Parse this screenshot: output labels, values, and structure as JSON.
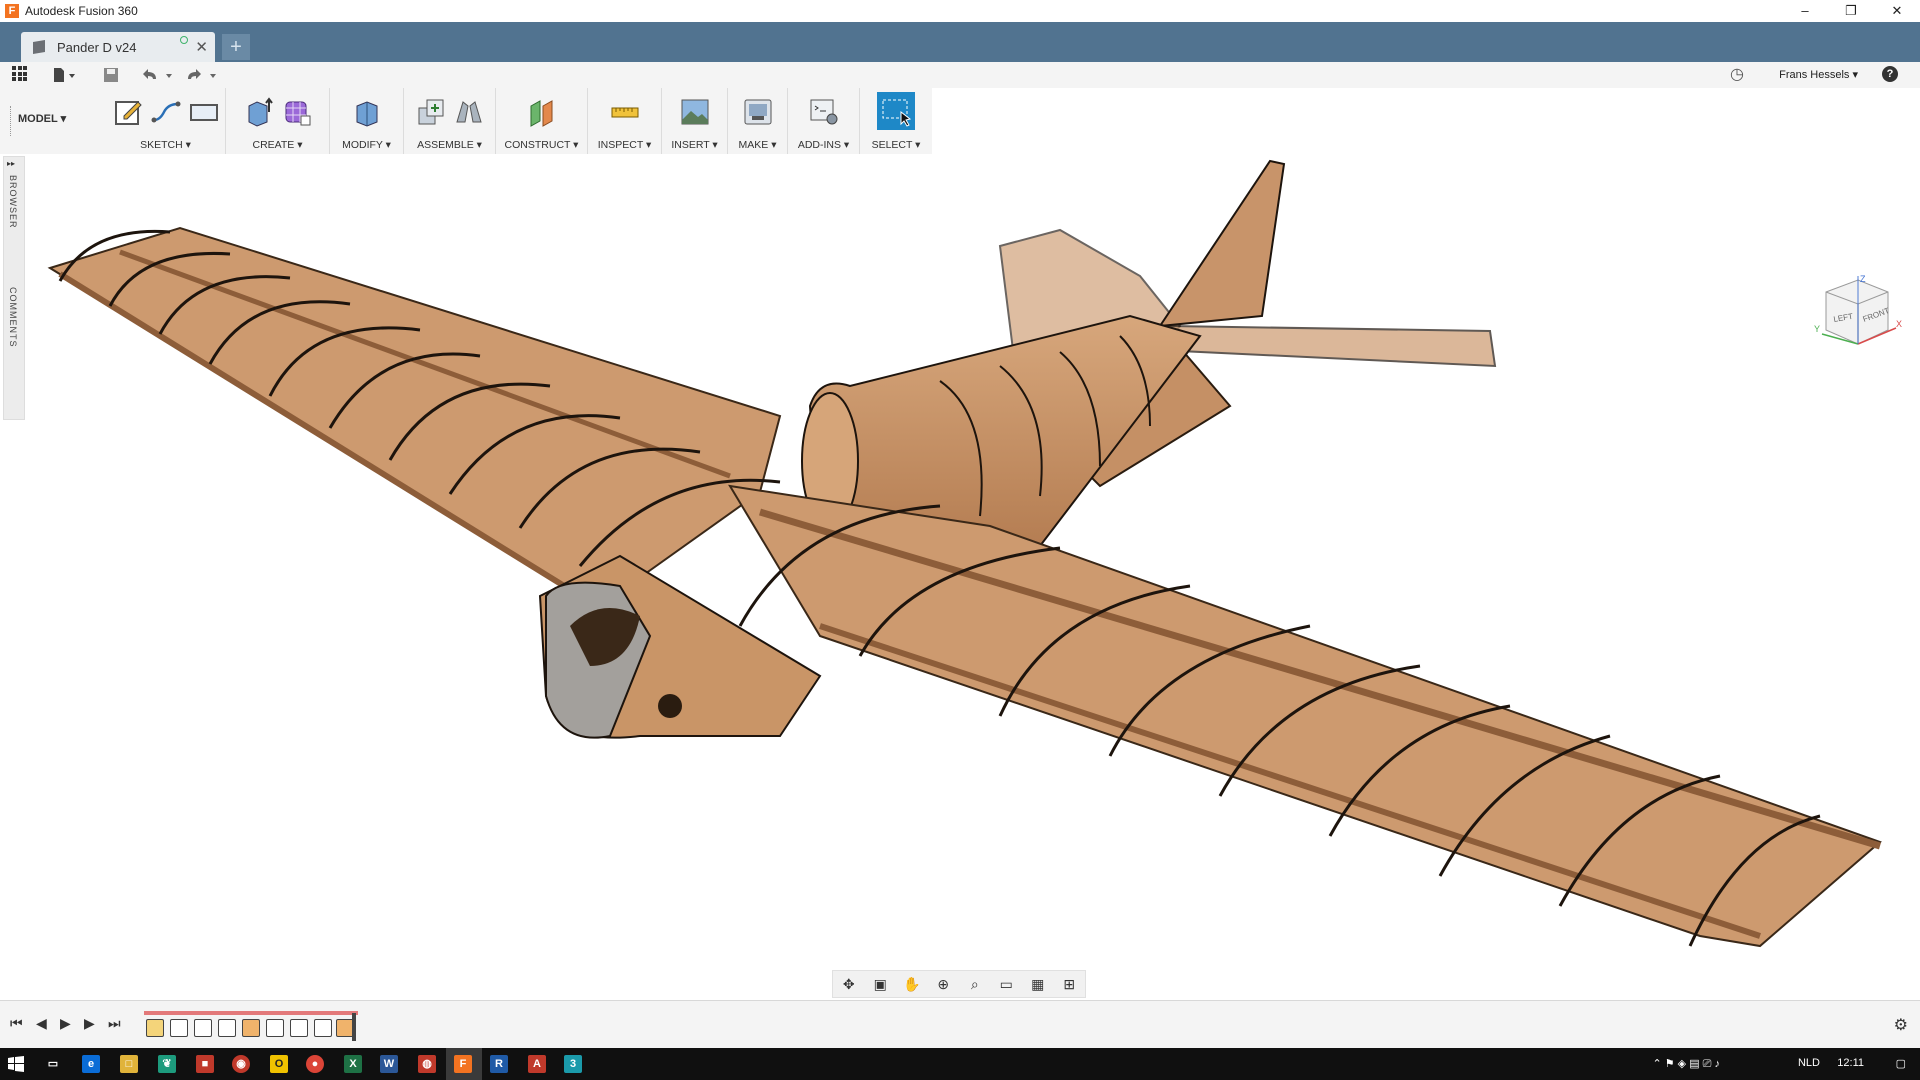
{
  "window": {
    "app_title": "Autodesk Fusion 360",
    "controls": [
      "–",
      "❐",
      "✕"
    ]
  },
  "tabs": {
    "document_title": "Pander D v24",
    "close_glyph": "✕",
    "new_tab_glyph": "+"
  },
  "quick_access": {
    "user_name": "Frans Hessels",
    "user_caret": "▾",
    "help_glyph": "?",
    "clock_glyph": "◷"
  },
  "toolbar": {
    "workspace": "MODEL ▾",
    "groups": [
      {
        "label": "SKETCH ▾"
      },
      {
        "label": "CREATE ▾"
      },
      {
        "label": "MODIFY ▾"
      },
      {
        "label": "ASSEMBLE ▾"
      },
      {
        "label": "CONSTRUCT ▾"
      },
      {
        "label": "INSPECT ▾"
      },
      {
        "label": "INSERT ▾"
      },
      {
        "label": "MAKE ▾"
      },
      {
        "label": "ADD-INS ▾"
      },
      {
        "label": "SELECT ▾"
      }
    ]
  },
  "left_panel": {
    "expand_glyph": "▸▸",
    "browser_label": "BROWSER",
    "comments_label": "COMMENTS"
  },
  "viewcube": {
    "left_face": "LEFT",
    "front_face": "FRONT",
    "axis_x": "X",
    "axis_y": "Y",
    "axis_z": "Z"
  },
  "timeline": {
    "first": "⏮",
    "prev": "◀",
    "play": "▶",
    "next": "▶",
    "last": "⏭",
    "gear": "⚙"
  },
  "taskbar": {
    "language": "NLD",
    "time": "12:11",
    "apps": [
      "e",
      "□",
      "❦",
      "■",
      "◉",
      "O",
      "●",
      "X",
      "W",
      "◍",
      "F",
      "R",
      "A",
      "3"
    ]
  },
  "colors": {
    "titlebar_tab_bg": "#517390",
    "wood": "#c8946a",
    "wood_dark": "#9b6b45",
    "edge": "#1f1610",
    "select_blue": "#1e88c7"
  }
}
